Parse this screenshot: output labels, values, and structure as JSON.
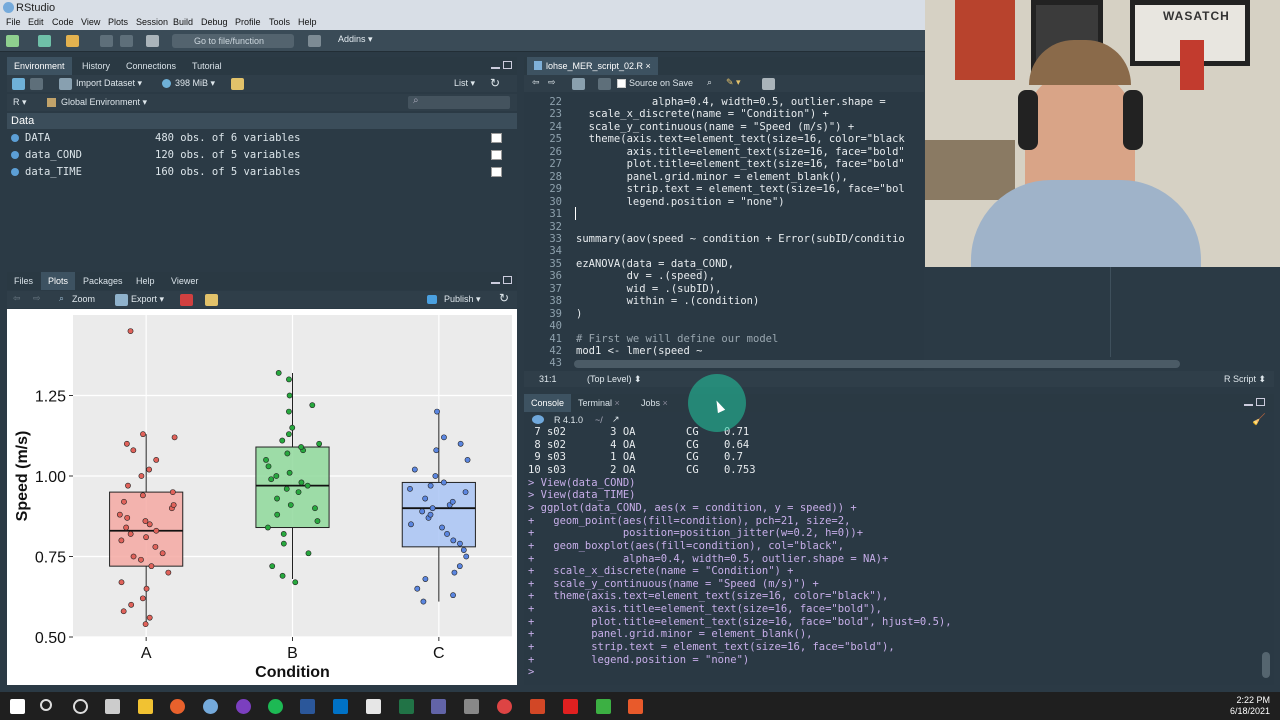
{
  "window": {
    "title": "RStudio"
  },
  "menu": [
    "File",
    "Edit",
    "Code",
    "View",
    "Plots",
    "Session",
    "Build",
    "Debug",
    "Profile",
    "Tools",
    "Help"
  ],
  "toolbar": {
    "goto_placeholder": "Go to file/function",
    "addins": "Addins"
  },
  "env_pane": {
    "tabs": [
      "Environment",
      "History",
      "Connections",
      "Tutorial"
    ],
    "import_label": "Import Dataset",
    "memory": "398 MiB",
    "view_mode": "List",
    "lang": "R",
    "scope": "Global Environment",
    "section": "Data",
    "rows": [
      {
        "name": "DATA",
        "value": "480 obs. of 6 variables"
      },
      {
        "name": "data_COND",
        "value": "120 obs. of 5 variables"
      },
      {
        "name": "data_TIME",
        "value": "160 obs. of 5 variables"
      }
    ]
  },
  "plots_pane": {
    "tabs": [
      "Files",
      "Plots",
      "Packages",
      "Help",
      "Viewer"
    ],
    "zoom_label": "Zoom",
    "export_label": "Export",
    "publish_label": "Publish"
  },
  "chart_data": {
    "type": "boxplot",
    "categories": [
      "A",
      "B",
      "C"
    ],
    "xlabel": "Condition",
    "ylabel": "Speed (m/s)",
    "ylim": [
      0.5,
      1.5
    ],
    "yticks": [
      "0.50",
      "0.75",
      "1.00",
      "1.25"
    ],
    "fill_colors": [
      "#f4a9a3",
      "#8fd99b",
      "#a9c4f5"
    ],
    "point_colors": [
      "#e0625a",
      "#27a83e",
      "#5b86e0"
    ],
    "boxes": [
      {
        "q1": 0.72,
        "median": 0.83,
        "q3": 0.95,
        "min": 0.54,
        "max": 1.13
      },
      {
        "q1": 0.84,
        "median": 0.97,
        "q3": 1.09,
        "min": 0.68,
        "max": 1.32
      },
      {
        "q1": 0.78,
        "median": 0.9,
        "q3": 0.98,
        "min": 0.61,
        "max": 1.2
      }
    ],
    "points": [
      [
        0.54,
        0.56,
        0.58,
        0.6,
        0.62,
        0.65,
        0.67,
        0.7,
        0.72,
        0.74,
        0.75,
        0.76,
        0.78,
        0.8,
        0.81,
        0.82,
        0.83,
        0.84,
        0.85,
        0.86,
        0.87,
        0.88,
        0.9,
        0.91,
        0.92,
        0.94,
        0.95,
        0.97,
        1.0,
        1.02,
        1.05,
        1.08,
        1.1,
        1.12,
        1.13,
        1.45
      ],
      [
        0.67,
        0.69,
        0.72,
        0.76,
        0.79,
        0.82,
        0.84,
        0.86,
        0.88,
        0.9,
        0.91,
        0.93,
        0.95,
        0.96,
        0.97,
        0.98,
        0.99,
        1.0,
        1.01,
        1.03,
        1.05,
        1.07,
        1.08,
        1.09,
        1.1,
        1.11,
        1.13,
        1.15,
        1.2,
        1.22,
        1.25,
        1.3,
        1.32
      ],
      [
        0.61,
        0.63,
        0.65,
        0.68,
        0.7,
        0.72,
        0.75,
        0.77,
        0.79,
        0.8,
        0.82,
        0.84,
        0.85,
        0.87,
        0.88,
        0.89,
        0.9,
        0.91,
        0.92,
        0.93,
        0.95,
        0.96,
        0.97,
        0.98,
        1.0,
        1.02,
        1.05,
        1.08,
        1.1,
        1.12,
        1.2
      ]
    ]
  },
  "editor": {
    "tab_title": "lohse_MER_script_02.R",
    "source_on_save": "Source on Save",
    "status_pos": "31:1",
    "status_scope": "(Top Level)",
    "status_type": "R Script",
    "lines": [
      {
        "n": "22",
        "t": "            alpha=0.4, width=0.5, outlier.shape ="
      },
      {
        "n": "23",
        "t": "  scale_x_discrete(name = \"Condition\") +"
      },
      {
        "n": "24",
        "t": "  scale_y_continuous(name = \"Speed (m/s)\") +"
      },
      {
        "n": "25",
        "t": "  theme(axis.text=element_text(size=16, color=\"black"
      },
      {
        "n": "26",
        "t": "        axis.title=element_text(size=16, face=\"bold\""
      },
      {
        "n": "27",
        "t": "        plot.title=element_text(size=16, face=\"bold\""
      },
      {
        "n": "28",
        "t": "        panel.grid.minor = element_blank(),"
      },
      {
        "n": "29",
        "t": "        strip.text = element_text(size=16, face=\"bol"
      },
      {
        "n": "30",
        "t": "        legend.position = \"none\")"
      },
      {
        "n": "31",
        "t": ""
      },
      {
        "n": "32",
        "t": ""
      },
      {
        "n": "33",
        "t": "summary(aov(speed ~ condition + Error(subID/conditio"
      },
      {
        "n": "34",
        "t": ""
      },
      {
        "n": "35",
        "t": "ezANOVA(data = data_COND,"
      },
      {
        "n": "36",
        "t": "        dv = .(speed),"
      },
      {
        "n": "37",
        "t": "        wid = .(subID),"
      },
      {
        "n": "38",
        "t": "        within = .(condition)"
      },
      {
        "n": "39",
        "t": ")"
      },
      {
        "n": "40",
        "t": ""
      },
      {
        "n": "41",
        "t": "# First we will define our model"
      },
      {
        "n": "42",
        "t": "mod1 <- lmer(speed ~"
      },
      {
        "n": "43",
        "t": ""
      }
    ]
  },
  "console": {
    "tabs": [
      "Console",
      "Terminal",
      "Jobs"
    ],
    "version": "R 4.1.0",
    "path": "~/",
    "output": [
      {
        "t": " 7 s02       3 OA        CG    0.71",
        "cmd": false
      },
      {
        "t": " 8 s02       4 OA        CG    0.64",
        "cmd": false
      },
      {
        "t": " 9 s03       1 OA        CG    0.7",
        "cmd": false
      },
      {
        "t": "10 s03       2 OA        CG    0.753",
        "cmd": false
      },
      {
        "t": "> View(data_COND)",
        "cmd": true
      },
      {
        "t": "> View(data_TIME)",
        "cmd": true
      },
      {
        "t": "> ggplot(data_COND, aes(x = condition, y = speed)) +",
        "cmd": true
      },
      {
        "t": "+   geom_point(aes(fill=condition), pch=21, size=2,",
        "cmd": true
      },
      {
        "t": "+              position=position_jitter(w=0.2, h=0))+",
        "cmd": true
      },
      {
        "t": "+   geom_boxplot(aes(fill=condition), col=\"black\",",
        "cmd": true
      },
      {
        "t": "+              alpha=0.4, width=0.5, outlier.shape = NA)+",
        "cmd": true
      },
      {
        "t": "+   scale_x_discrete(name = \"Condition\") +",
        "cmd": true
      },
      {
        "t": "+   scale_y_continuous(name = \"Speed (m/s)\") +",
        "cmd": true
      },
      {
        "t": "+   theme(axis.text=element_text(size=16, color=\"black\"),",
        "cmd": true
      },
      {
        "t": "+         axis.title=element_text(size=16, face=\"bold\"),",
        "cmd": true
      },
      {
        "t": "+         plot.title=element_text(size=16, face=\"bold\", hjust=0.5),",
        "cmd": true
      },
      {
        "t": "+         panel.grid.minor = element_blank(),",
        "cmd": true
      },
      {
        "t": "+         strip.text = element_text(size=16, face=\"bold\"),",
        "cmd": true
      },
      {
        "t": "+         legend.position = \"none\")",
        "cmd": true
      },
      {
        "t": ">",
        "cmd": true
      }
    ]
  },
  "taskbar": {
    "time": "2:22 PM",
    "date": "6/18/2021"
  },
  "webcam": {
    "poster_text": "WASATCH"
  }
}
